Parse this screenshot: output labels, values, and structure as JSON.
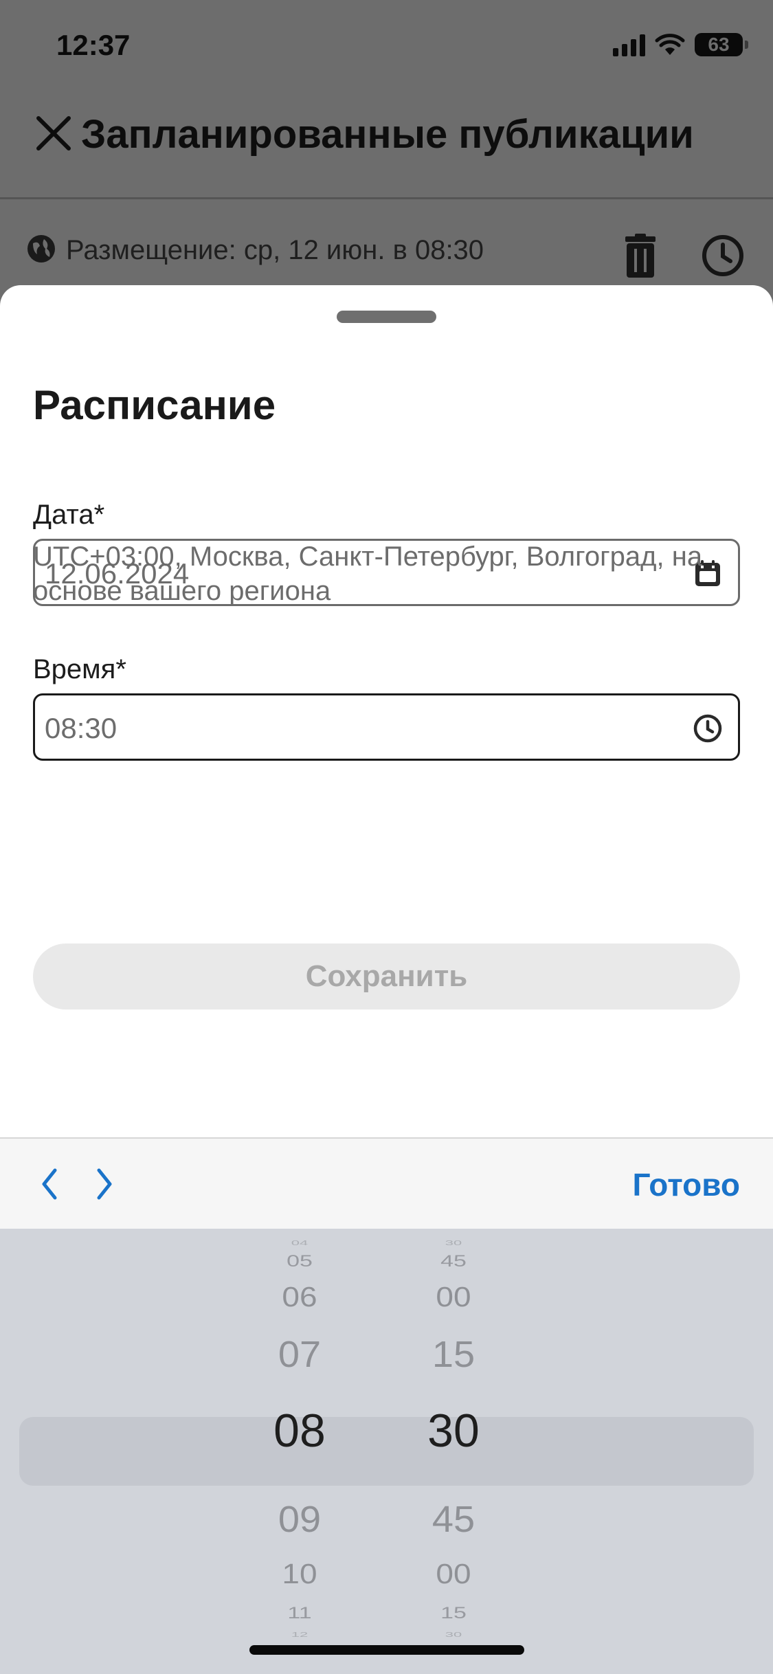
{
  "status_bar": {
    "time": "12:37",
    "battery": "63"
  },
  "background": {
    "title": "Запланированные публикации",
    "row_text": "Размещение: ср, 12 июн. в 08:30"
  },
  "sheet": {
    "title": "Расписание",
    "date_label": "Дата*",
    "date_value": "12.06.2024",
    "time_label": "Время*",
    "time_value": "08:30",
    "timezone_note": "UTC+03:00, Москва, Санкт-Петербург, Волгоград, на основе вашего региона",
    "save_label": "Сохранить"
  },
  "toolbar": {
    "done_label": "Готово"
  },
  "picker": {
    "hours": [
      "04",
      "05",
      "06",
      "07",
      "08",
      "09",
      "10",
      "11",
      "12"
    ],
    "minutes": [
      "30",
      "45",
      "00",
      "15",
      "30",
      "45",
      "00",
      "15",
      "30"
    ],
    "selected_hour": "08",
    "selected_minute": "30"
  },
  "colors": {
    "accent": "#1a73c9",
    "picker_bg": "#d1d4da",
    "dim_bg": "#6d6d6d"
  },
  "icons": [
    "close-icon",
    "globe-icon",
    "trash-icon",
    "clock-icon",
    "calendar-icon",
    "chevron-left-icon",
    "chevron-right-icon",
    "signal-icon",
    "wifi-icon",
    "battery-icon"
  ]
}
